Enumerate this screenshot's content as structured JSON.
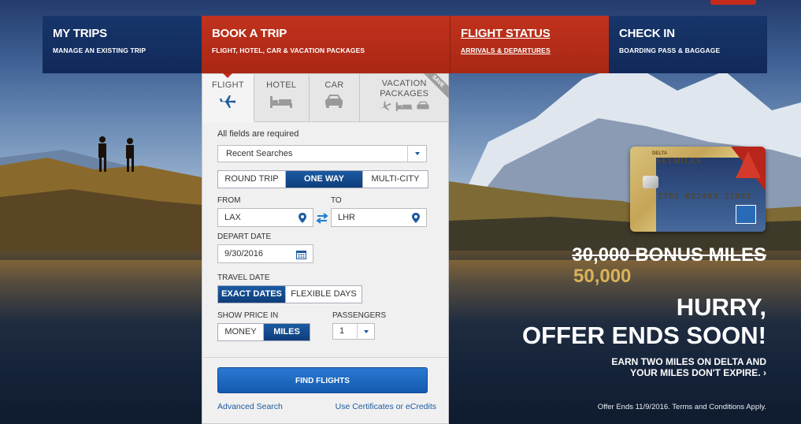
{
  "nav": [
    {
      "title": "MY TRIPS",
      "sub": "MANAGE AN EXISTING TRIP"
    },
    {
      "title": "BOOK A TRIP",
      "sub": "FLIGHT, HOTEL, CAR & VACATION PACKAGES"
    },
    {
      "title": "FLIGHT STATUS",
      "sub": "ARRIVALS & DEPARTURES"
    },
    {
      "title": "CHECK IN",
      "sub": "BOARDING PASS & BAGGAGE"
    }
  ],
  "tabs": {
    "flight": "FLIGHT",
    "hotel": "HOTEL",
    "car": "CAR",
    "vacation": "VACATION PACKAGES",
    "save_badge": "SAVE"
  },
  "form": {
    "required_note": "All fields are required",
    "recent_searches": "Recent Searches",
    "trip_types": [
      "ROUND TRIP",
      "ONE WAY",
      "MULTI-CITY"
    ],
    "selected_trip_type": "ONE WAY",
    "from_label": "FROM",
    "from_value": "LAX",
    "to_label": "TO",
    "to_value": "LHR",
    "depart_label": "DEPART DATE",
    "depart_value": "9/30/2016",
    "travel_date_label": "TRAVEL DATE",
    "travel_date_options": [
      "EXACT DATES",
      "FLEXIBLE DAYS"
    ],
    "price_label": "SHOW PRICE IN",
    "price_options": [
      "MONEY",
      "MILES"
    ],
    "passengers_label": "PASSENGERS",
    "passengers_value": "1",
    "find_button": "FIND FLIGHTS",
    "advanced_link": "Advanced Search",
    "certificates_link": "Use Certificates or eCredits"
  },
  "promo": {
    "card_brand": "DELTA",
    "card_name": "SKYMILES",
    "card_number": "3782 822463 21001",
    "old_miles": "30,000 BONUS MILES",
    "new_miles": "50,000",
    "hurry_line1": "HURRY,",
    "hurry_line2": "OFFER ENDS SOON!",
    "earn_line1": "EARN TWO MILES ON DELTA AND",
    "earn_line2": "YOUR MILES DON'T EXPIRE.",
    "fine_print": "Offer Ends 11/9/2016. Terms and Conditions Apply."
  },
  "colors": {
    "delta_blue": "#11295a",
    "delta_red": "#c1321d",
    "button_blue": "#1459b0"
  }
}
